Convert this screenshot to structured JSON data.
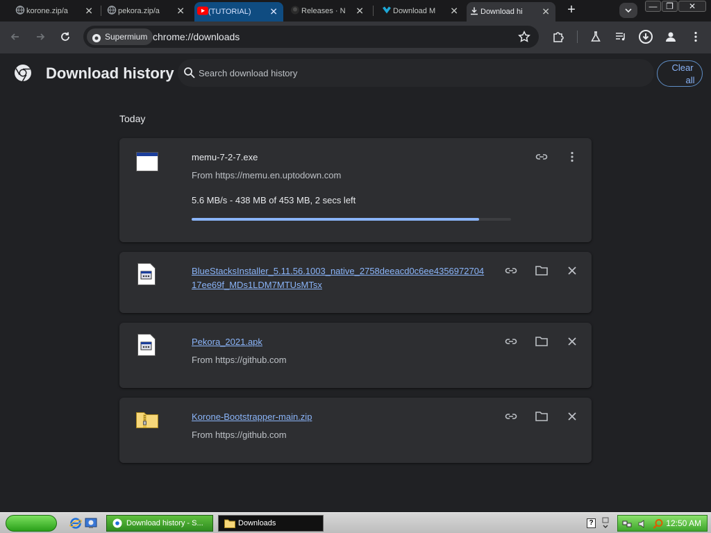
{
  "tabs": [
    {
      "title": "korone.zip/a",
      "icon": "globe-icon",
      "state": "normal"
    },
    {
      "title": "pekora.zip/a",
      "icon": "globe-icon",
      "state": "normal"
    },
    {
      "title": "(TUTORIAL)",
      "icon": "youtube-icon",
      "state": "hover"
    },
    {
      "title": "Releases · N",
      "icon": "github-icon",
      "state": "normal"
    },
    {
      "title": "Download M",
      "icon": "uptodown-icon",
      "state": "normal"
    },
    {
      "title": "Download hi",
      "icon": "download-icon",
      "state": "active"
    }
  ],
  "window_controls": {
    "minimize": "—",
    "restore": "❐",
    "close": "✕"
  },
  "toolbar": {
    "site_chip": "Supermium",
    "url": "chrome://downloads"
  },
  "header": {
    "title": "Download history",
    "search_placeholder": "Search download history",
    "clear_all_line1": "Clear",
    "clear_all_line2": "all"
  },
  "section_date": "Today",
  "downloads": [
    {
      "name": "memu-7-2-7.exe",
      "source": "From https://memu.en.uptodown.com",
      "progress_text": "5.6 MB/s - 438 MB of 453 MB, 2 secs left",
      "progress_fraction": 0.9,
      "status": "in-progress"
    },
    {
      "name_line1": "BlueStacksInstaller_5.11.56.1003_native_2758deeacd0c6ee4356972704",
      "name_line2": "17ee69f_MDs1LDM7MTUsMTsx",
      "status": "complete"
    },
    {
      "name": "Pekora_2021.apk",
      "source": "From https://github.com",
      "status": "complete"
    },
    {
      "name": "Korone-Bootstrapper-main.zip",
      "source": "From https://github.com",
      "status": "complete"
    }
  ],
  "taskbar": {
    "items": [
      {
        "label": "Download history - S..."
      },
      {
        "label": "Downloads"
      }
    ],
    "help_glyph": "?",
    "clock": "12:50 AM"
  },
  "colors": {
    "accent": "#8ab4f8",
    "background": "#202124",
    "card": "#2d2e31"
  }
}
